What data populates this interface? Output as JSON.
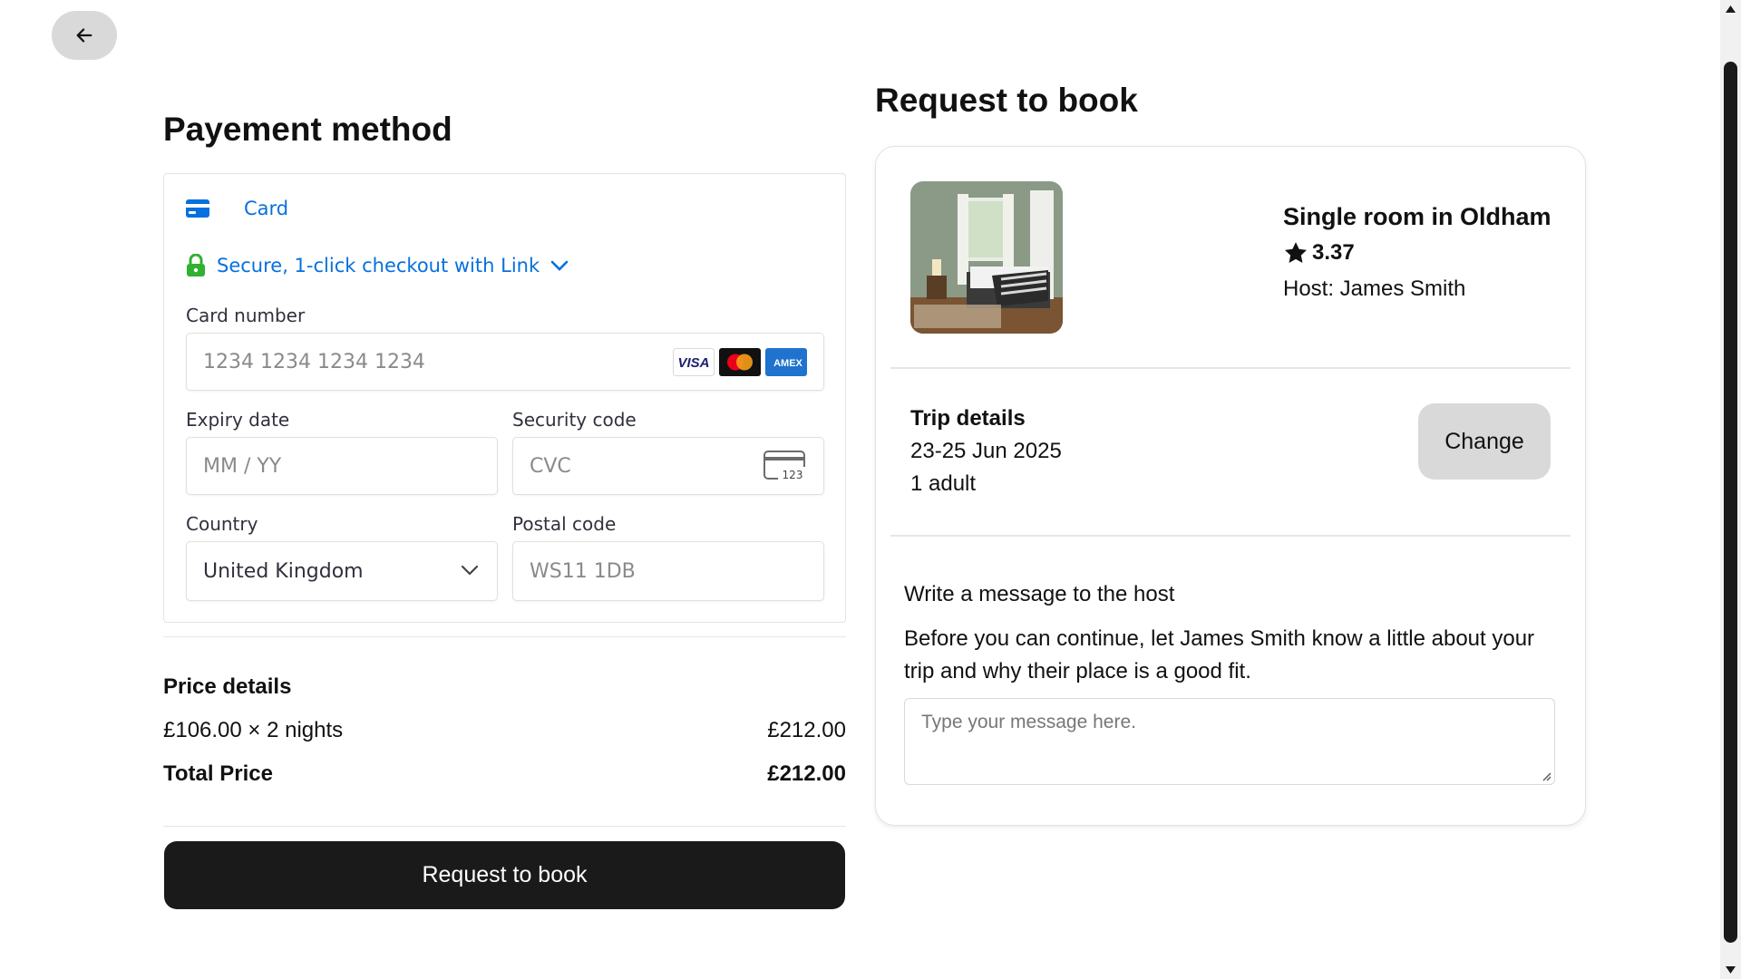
{
  "navigation": {
    "back_icon": "arrow-left-icon"
  },
  "payment": {
    "title": "Payement method",
    "card_tab": {
      "label": "Card",
      "icon": "credit-card-icon"
    },
    "link": {
      "label": "Secure, 1-click checkout with Link",
      "icon": "lock-icon",
      "chevron": "chevron-down-icon"
    },
    "card_number": {
      "label": "Card number",
      "placeholder": "1234 1234 1234 1234",
      "brands": [
        "VISA",
        "mastercard",
        "AMEX"
      ]
    },
    "expiry": {
      "label": "Expiry date",
      "placeholder": "MM / YY"
    },
    "security": {
      "label": "Security code",
      "placeholder": "CVC",
      "icon_text": "123"
    },
    "country": {
      "label": "Country",
      "value": "United Kingdom"
    },
    "postal": {
      "label": "Postal code",
      "placeholder": "WS11 1DB"
    }
  },
  "price": {
    "title": "Price details",
    "line_label": "£106.00 × 2 nights",
    "line_value": "£212.00",
    "total_label": "Total Price",
    "total_value": "£212.00"
  },
  "book_button": "Request to book",
  "request": {
    "title": "Request to book",
    "listing": {
      "title": "Single room in Oldham",
      "rating": "3.37",
      "host": "Host: James Smith"
    },
    "trip": {
      "title": "Trip details",
      "dates": "23-25 Jun 2025",
      "guests": "1 adult",
      "change_label": "Change"
    },
    "message": {
      "heading": "Write a message to the host",
      "description": "Before you can continue, let James Smith know a little about your trip and why their place is a good fit.",
      "placeholder": "Type your message here."
    }
  },
  "colors": {
    "link_blue": "#0570de",
    "lock_green": "#30b130",
    "button_dark": "#1a1a1a",
    "button_gray": "#d9d9d9"
  }
}
